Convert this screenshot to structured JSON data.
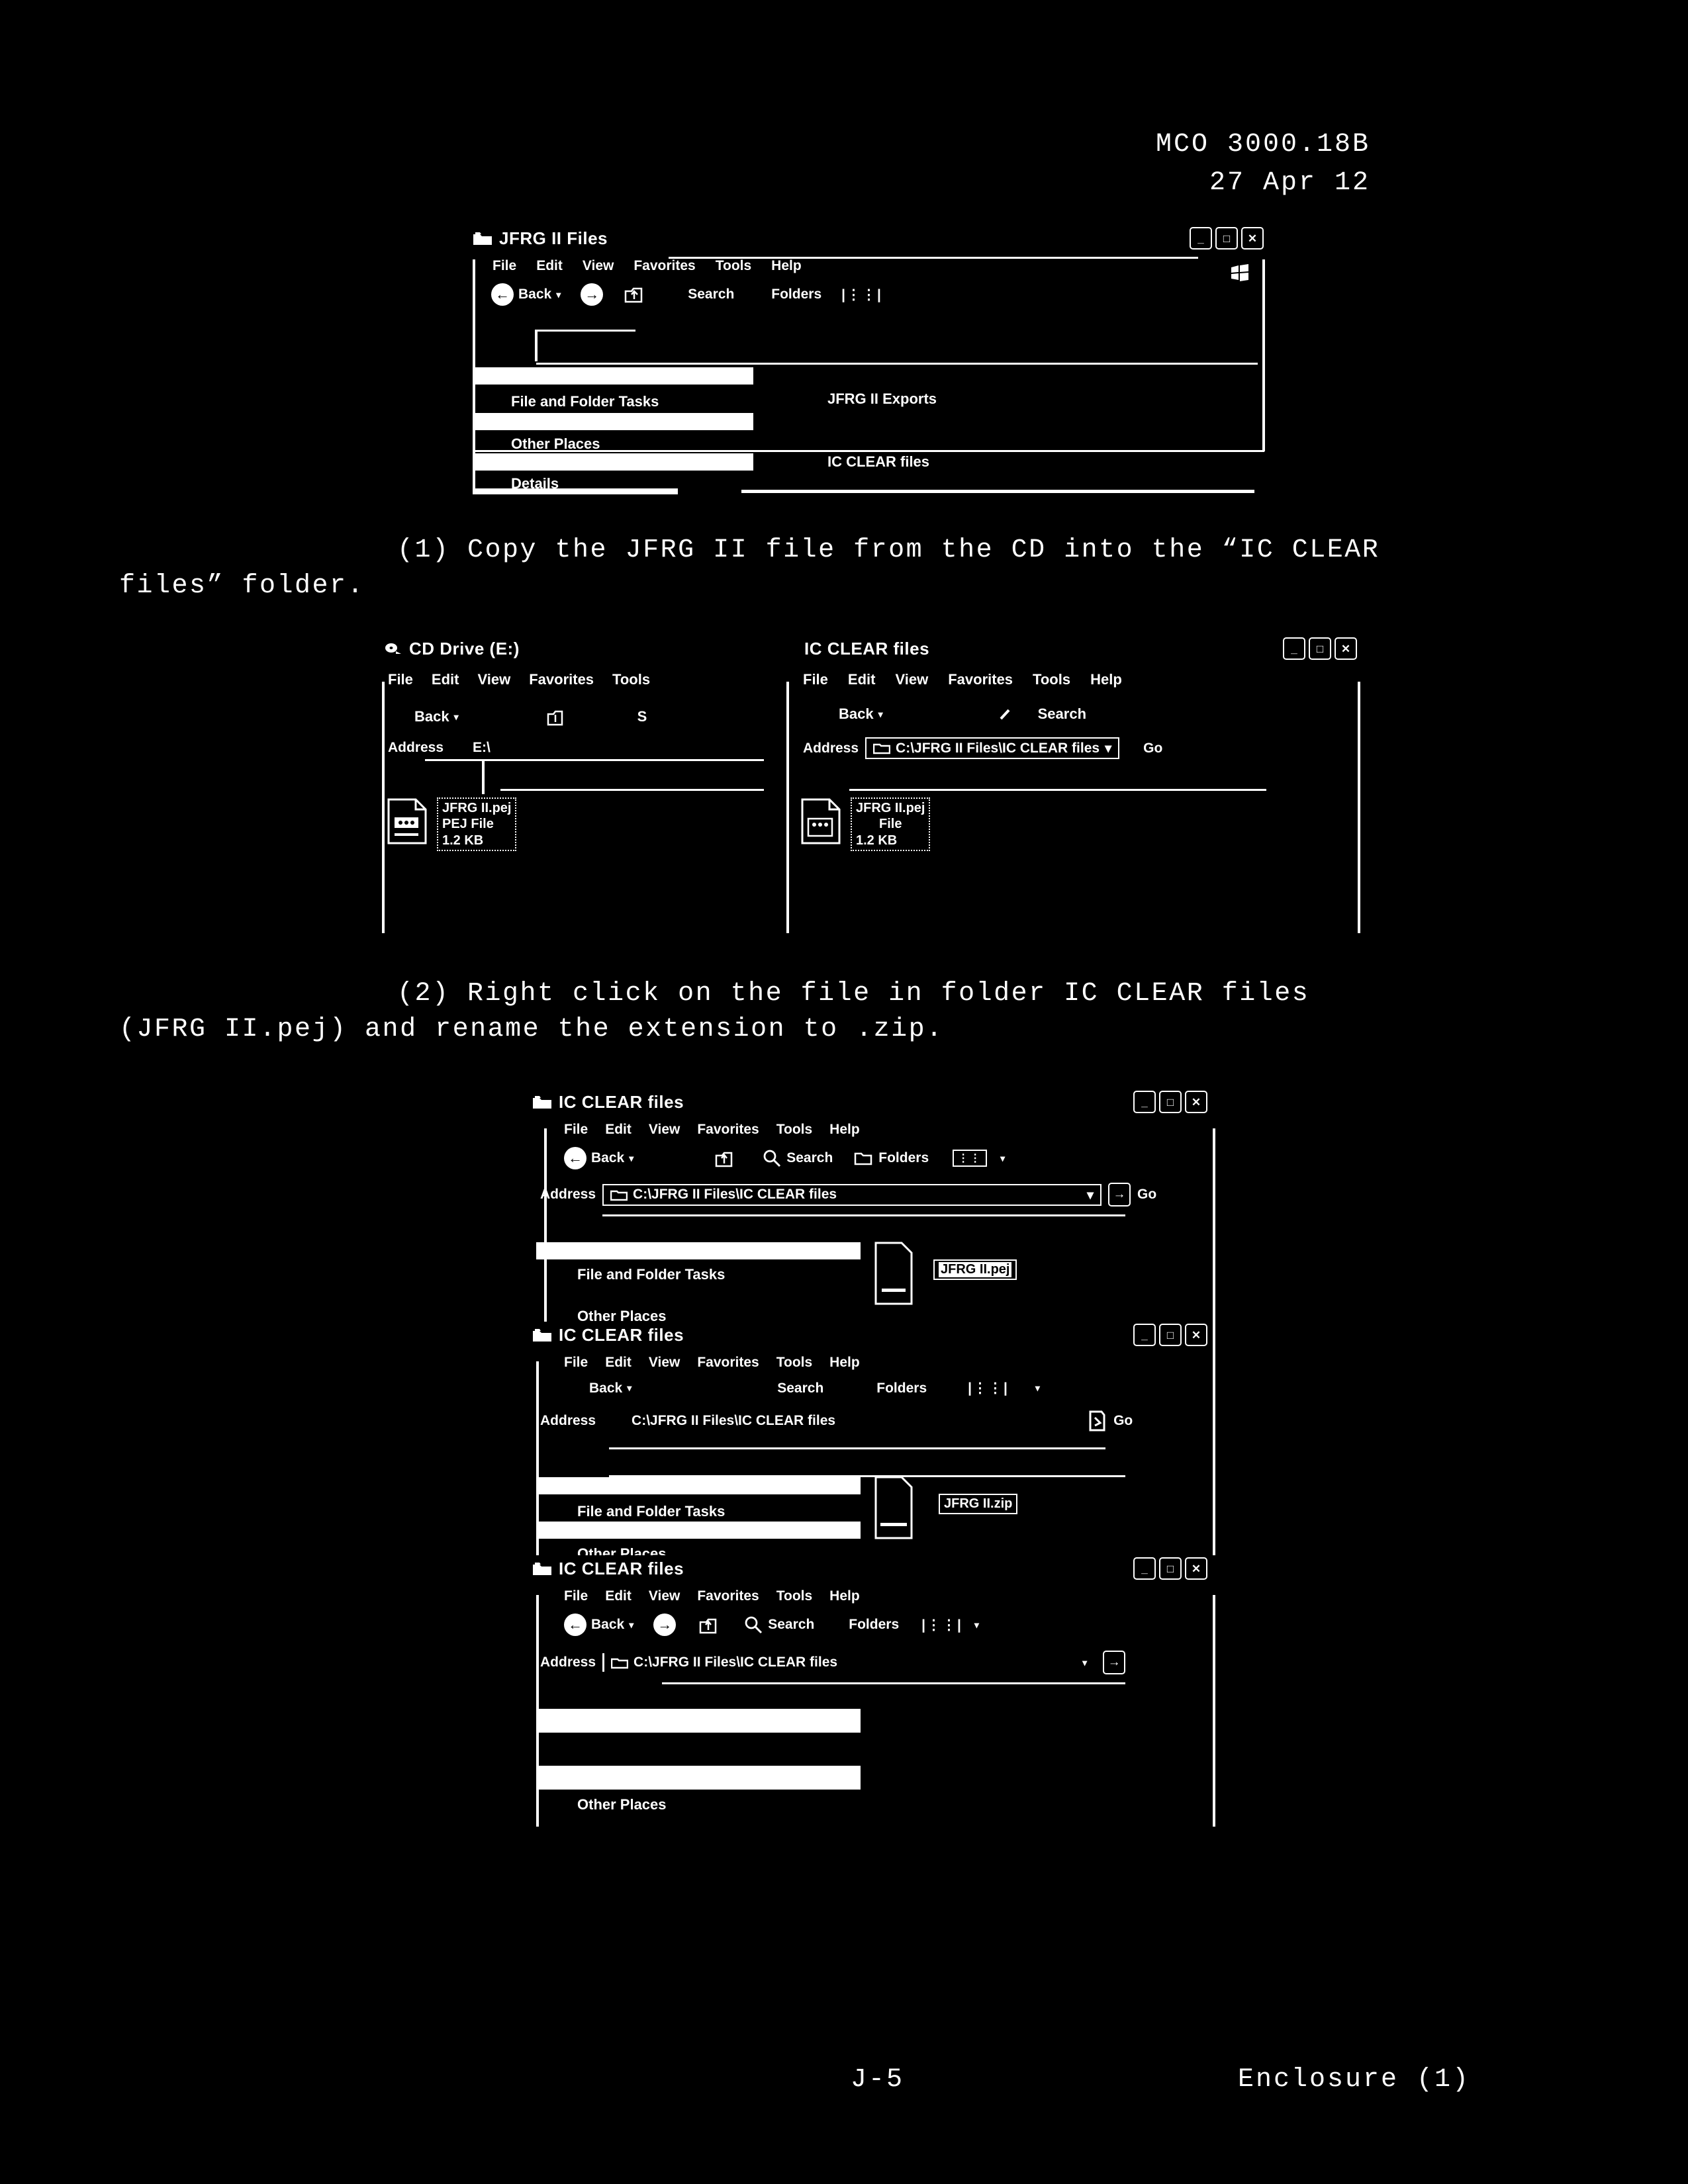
{
  "header": {
    "order_number": "MCO 3000.18B",
    "date": "27 Apr 12"
  },
  "footer": {
    "page_number": "J-5",
    "enclosure": "Enclosure (1)"
  },
  "paragraphs": [
    {
      "number": "(1)",
      "text": "Copy the JFRG II file from the CD into the “IC CLEAR",
      "line2": "files” folder."
    },
    {
      "number": "(2)",
      "text": "Right click on the file in folder IC CLEAR files",
      "line2": "(JFRG II.pej) and rename the extension to .zip."
    }
  ],
  "menu": {
    "file": "File",
    "edit": "Edit",
    "view": "View",
    "favorites": "Favorites",
    "tools": "Tools",
    "help": "Help"
  },
  "toolbar": {
    "back": "Back",
    "search": "Search",
    "folders": "Folders",
    "go": "Go",
    "address": "Address"
  },
  "figure1": {
    "title": "JFRG II Files",
    "menu": [
      "File",
      "Edit",
      "View",
      "Favorites",
      "Tools",
      "Help"
    ],
    "toolbar": [
      "Back",
      "Search",
      "Folders"
    ],
    "sidebar": [
      "File and Folder Tasks",
      "Other Places",
      "Details"
    ],
    "folders": [
      "JFRG II Exports",
      "IC CLEAR files"
    ],
    "window_buttons": [
      "minimize",
      "maximize",
      "close"
    ]
  },
  "figure2": {
    "left": {
      "title": "CD Drive (E:)",
      "menu": [
        "File",
        "Edit",
        "View",
        "Favorites",
        "Tools"
      ],
      "back": "Back",
      "search_partial": "S",
      "address_label": "Address",
      "address_value": "E:\\",
      "file": {
        "name": "JFRG II.pej",
        "type": "PEJ File",
        "size": "1.2 KB"
      }
    },
    "right": {
      "title": "IC CLEAR files",
      "menu": [
        "File",
        "Edit",
        "View",
        "Favorites",
        "Tools",
        "Help"
      ],
      "back": "Back",
      "search": "Search",
      "address_label": "Address",
      "address_value": "C:\\JFRG II Files\\IC CLEAR files",
      "go": "Go",
      "file": {
        "name": "JFRG II.pej",
        "type": "File",
        "size": "1.2 KB"
      }
    }
  },
  "figure3": {
    "windows": [
      {
        "title": "IC CLEAR files",
        "menu": [
          "File",
          "Edit",
          "View",
          "Favorites",
          "Tools",
          "Help"
        ],
        "toolbar": [
          "Back",
          "Search",
          "Folders"
        ],
        "address_label": "Address",
        "address_value": "C:\\JFRG II Files\\IC CLEAR files",
        "go": "Go",
        "sidebar": [
          "File and Folder Tasks",
          "Other Places"
        ],
        "selected_file": "JFRG II.pej"
      },
      {
        "title": "IC CLEAR files",
        "menu": [
          "File",
          "Edit",
          "View",
          "Favorites",
          "Tools",
          "Help"
        ],
        "toolbar": [
          "Back",
          "Search",
          "Folders"
        ],
        "address_label": "Address",
        "address_value": "C:\\JFRG II Files\\IC CLEAR files",
        "go": "Go",
        "sidebar": [
          "File and Folder Tasks",
          "Other Places"
        ],
        "selected_file": "JFRG II.zip"
      },
      {
        "title": "IC CLEAR files",
        "menu": [
          "File",
          "Edit",
          "View",
          "Favorites",
          "Tools",
          "Help"
        ],
        "toolbar": [
          "Back",
          "Search",
          "Folders"
        ],
        "address_label": "Address",
        "address_value": "C:\\JFRG II Files\\IC CLEAR files",
        "sidebar": [
          "Other Places"
        ],
        "selected_file": ""
      }
    ]
  },
  "icons": {
    "minimize": "_",
    "maximize": "□",
    "close": "✕",
    "caret_down": "▾",
    "back_arrow": "←",
    "forward_arrow": "→",
    "go_arrow": "→",
    "search": "search-icon",
    "folder": "folder-icon",
    "cd": "cd-icon",
    "up": "up-folder-icon",
    "views": "views-icon",
    "windows_flag": "windows-flag-icon"
  }
}
